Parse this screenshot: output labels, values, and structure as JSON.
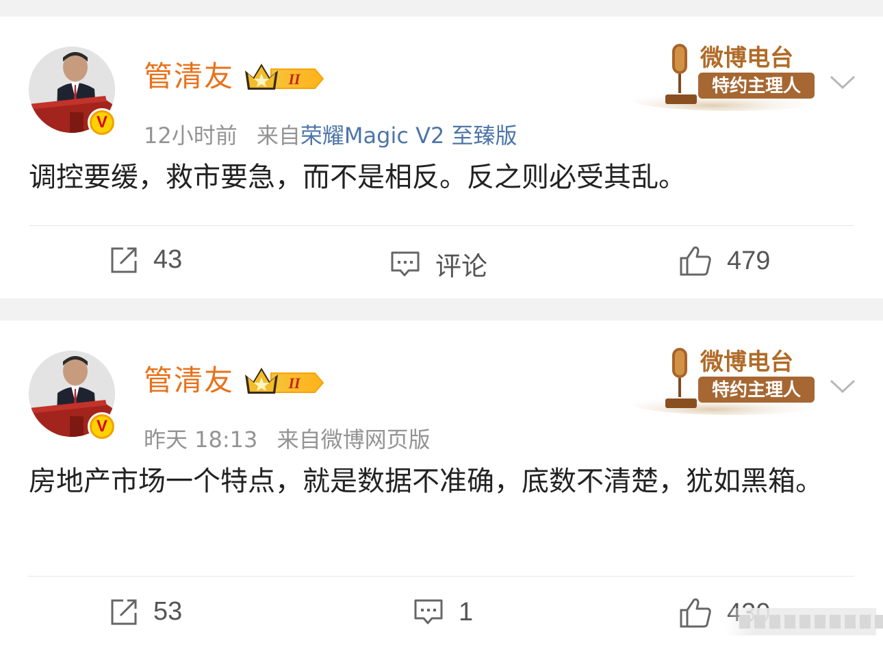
{
  "posts": [
    {
      "username": "管清友",
      "level": "II",
      "time": "12小时前",
      "source_prefix": "来自",
      "source": "荣耀Magic V2 至臻版",
      "content": "调控要缓，救市要急，而不是相反。反之则必受其乱。",
      "radio_badge": {
        "line1": "微博电台",
        "line2": "特约主理人"
      },
      "repost_count": "43",
      "comment_label": "评论",
      "like_count": "479"
    },
    {
      "username": "管清友",
      "level": "II",
      "time": "昨天 18:13",
      "source_prefix": "来自",
      "source": "微博网页版",
      "content": "房地产市场一个特点，就是数据不准确，底数不清楚，犹如黑箱。",
      "radio_badge": {
        "line1": "微博电台",
        "line2": "特约主理人"
      },
      "repost_count": "53",
      "comment_label": "1",
      "like_count": "430"
    }
  ],
  "verified_badge": "V",
  "icons": {
    "repost": "repost-icon",
    "comment": "comment-icon",
    "like": "thumbs-up-icon",
    "more": "chevron-down-icon"
  },
  "colors": {
    "username": "#e8711a",
    "source_link": "#4d75a8",
    "meta": "#939393",
    "background": "#f2f2f2"
  }
}
